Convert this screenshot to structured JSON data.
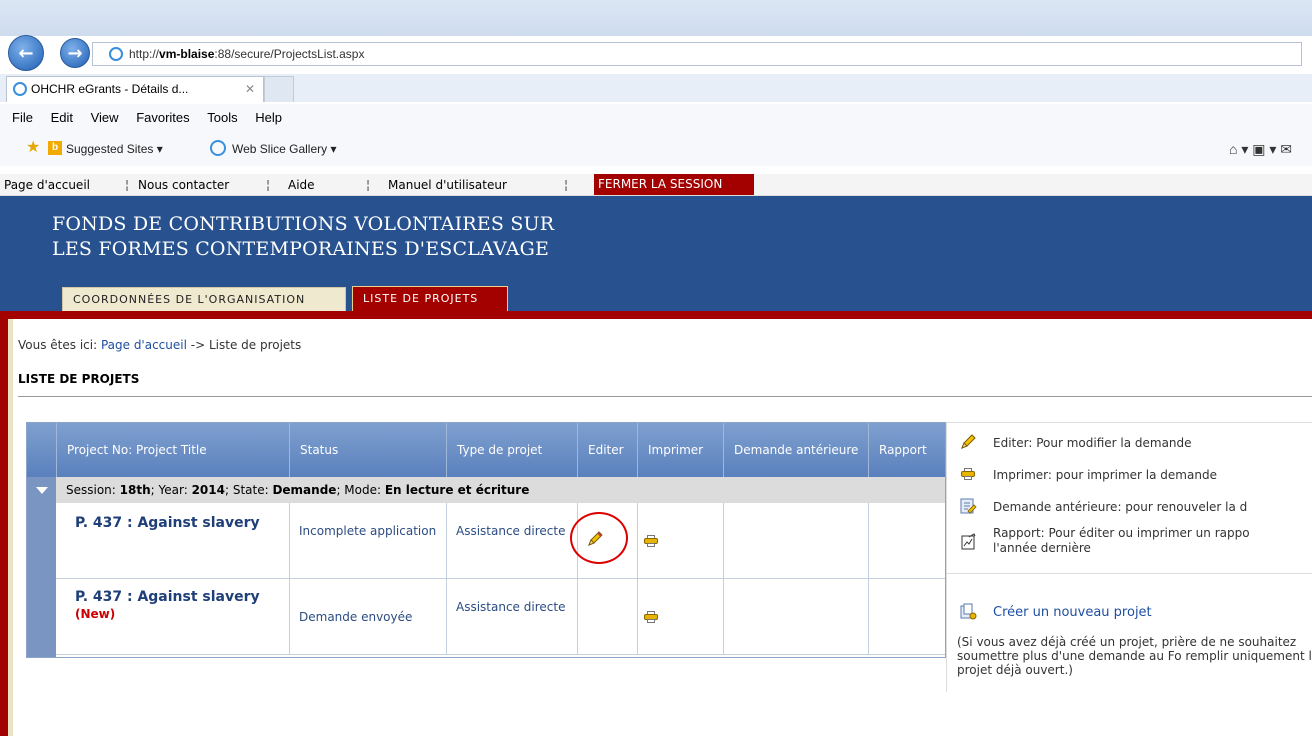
{
  "browser": {
    "url_prefix": "http://",
    "url_host": "vm-blaise",
    "url_rest": ":88/secure/ProjectsList.aspx",
    "tab_title": "OHCHR eGrants - Détails d...",
    "tab_close": "✕",
    "menu": [
      "File",
      "Edit",
      "View",
      "Favorites",
      "Tools",
      "Help"
    ],
    "favorites": {
      "suggested": "Suggested Sites ▾",
      "webslice": "Web Slice Gallery ▾",
      "right_tools": "⌂ ▾  ▣ ▾ ✉"
    }
  },
  "topnav": {
    "items": [
      "Page d'accueil",
      "Nous contacter",
      "Aide",
      "Manuel d'utilisateur"
    ],
    "separator": "¦",
    "logout": "FERMER LA SESSION"
  },
  "banner": {
    "line1": "FONDS DE CONTRIBUTIONS VOLONTAIRES SUR",
    "line2": "LES FORMES CONTEMPORAINES D'ESCLAVAGE",
    "tab_org": "COORDONNÉES DE L'ORGANISATION",
    "tab_projects": "LISTE DE PROJETS"
  },
  "breadcrumb": {
    "prefix": "Vous êtes ici: ",
    "home": "Page d'accueil",
    "rest": " -> Liste de projets"
  },
  "page_title": "LISTE DE PROJETS",
  "grid": {
    "headers": {
      "title": "Project No: Project Title",
      "status": "Status",
      "type": "Type de projet",
      "edit": "Editer",
      "print": "Imprimer",
      "previous": "Demande antérieure",
      "report": "Rapport"
    },
    "group": {
      "session_label": "Session: ",
      "session": "18th",
      "year_label": "; Year: ",
      "year": "2014",
      "state_label": "; State: ",
      "state": "Demande",
      "mode_label": "; Mode: ",
      "mode": "En lecture et écriture"
    },
    "rows": [
      {
        "title": "P. 437 : Against slavery",
        "new": "",
        "status": "Incomplete application",
        "type": "Assistance directe"
      },
      {
        "title": "P. 437 : Against slavery",
        "new": "(New)",
        "status": "Demande envoyée",
        "type": "Assistance directe"
      }
    ]
  },
  "legend": {
    "edit": "Editer: Pour modifier la demande",
    "print": "Imprimer: pour imprimer la demande",
    "previous": "Demande antérieure: pour renouveler la d",
    "report_1": "Rapport: Pour éditer ou imprimer un rappo",
    "report_2": "l'année dernière",
    "create": "Créer un nouveau projet",
    "note": "(Si vous avez déjà créé un projet, prière de ne souhaitez soumettre plus d'une demande au Fo remplir uniquement le projet déjà ouvert.)"
  },
  "colors": {
    "banner": "#27528f",
    "accent_red": "#a30000",
    "grid_header": "#5a80bd"
  }
}
